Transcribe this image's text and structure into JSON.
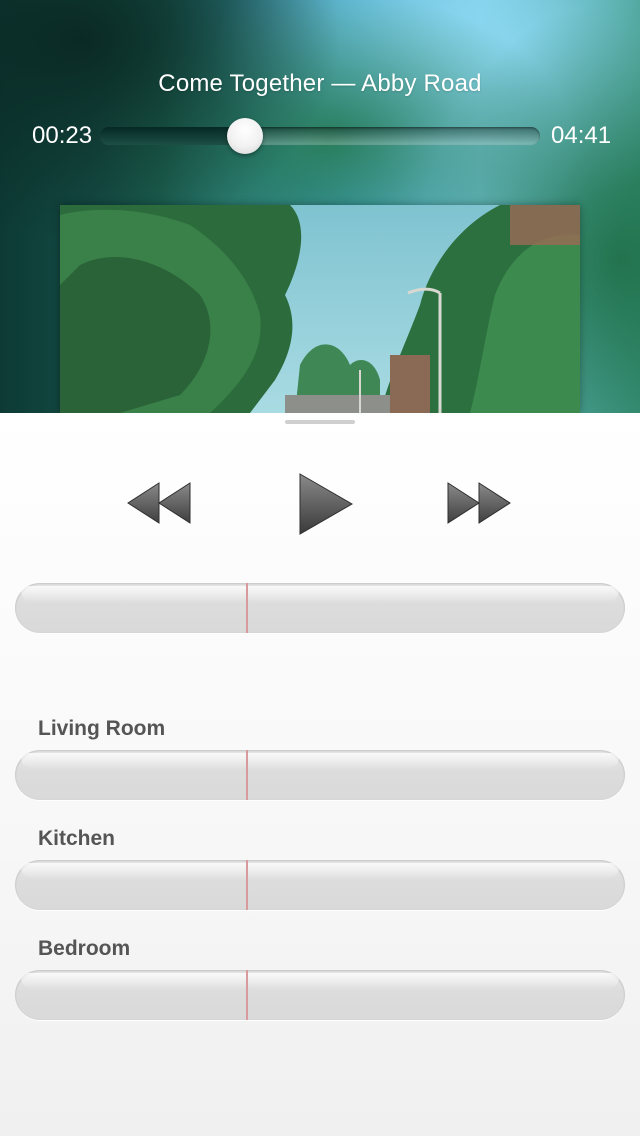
{
  "now_playing": {
    "title_line": "Come Together  —  Abby Road",
    "elapsed": "00:23",
    "duration": "04:41",
    "progress_fraction": 0.33
  },
  "artwork": {
    "sky_color": "#8fcfdc",
    "foliage_color": "#2f7a45"
  },
  "transport": {
    "rewind_icon": "rewind-icon",
    "play_icon": "play-icon",
    "forward_icon": "fast-forward-icon"
  },
  "master_volume": {
    "level_fraction": 0.38
  },
  "rooms": [
    {
      "label": "Living Room",
      "level_fraction": 0.38
    },
    {
      "label": "Kitchen",
      "level_fraction": 0.38
    },
    {
      "label": "Bedroom",
      "level_fraction": 0.38
    }
  ],
  "colors": {
    "marker": "#d99a9e",
    "label_text": "#555555"
  }
}
